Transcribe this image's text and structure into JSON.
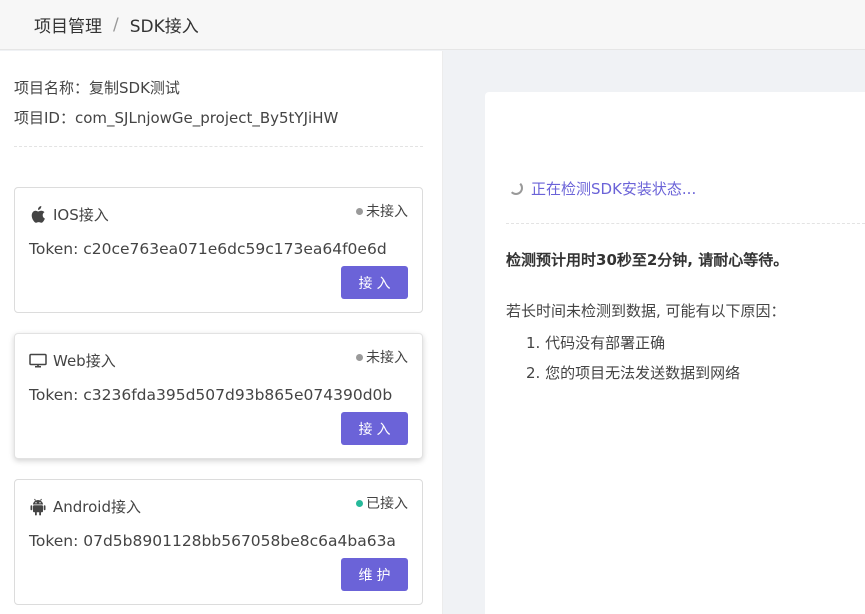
{
  "breadcrumb": {
    "parent": "项目管理",
    "separator": "/",
    "current": "SDK接入"
  },
  "project": {
    "name_line": "项目名称：复制SDK测试",
    "id_line": "项目ID：com_SJLnjowGe_project_By5tYJiHW"
  },
  "sdk_cards": [
    {
      "icon": "apple-icon",
      "title": "IOS接入",
      "status": "未接入",
      "status_color": "#9a9a9a",
      "token": "Token: c20ce763ea071e6dc59c173ea64f0e6d",
      "button": "接入"
    },
    {
      "icon": "monitor-icon",
      "title": "Web接入",
      "status": "未接入",
      "status_color": "#9a9a9a",
      "token": "Token: c3236fda395d507d93b865e074390d0b",
      "button": "接入"
    },
    {
      "icon": "android-icon",
      "title": "Android接入",
      "status": "已接入",
      "status_color": "#26b99a",
      "token": "Token: 07d5b8901128bb567058be8c6a4ba63a",
      "button": "维护"
    }
  ],
  "detection": {
    "status_text": "正在检测SDK安装状态...",
    "notice": "检测预计用时30秒至2分钟, 请耐心等待。",
    "reason_title": "若长时间未检测到数据, 可能有以下原因：",
    "reasons": [
      "1. 代码没有部署正确",
      "2. 您的项目无法发送数据到网络"
    ]
  },
  "colors": {
    "accent": "#6b63d8",
    "connected": "#26b99a",
    "not_connected": "#9a9a9a"
  }
}
